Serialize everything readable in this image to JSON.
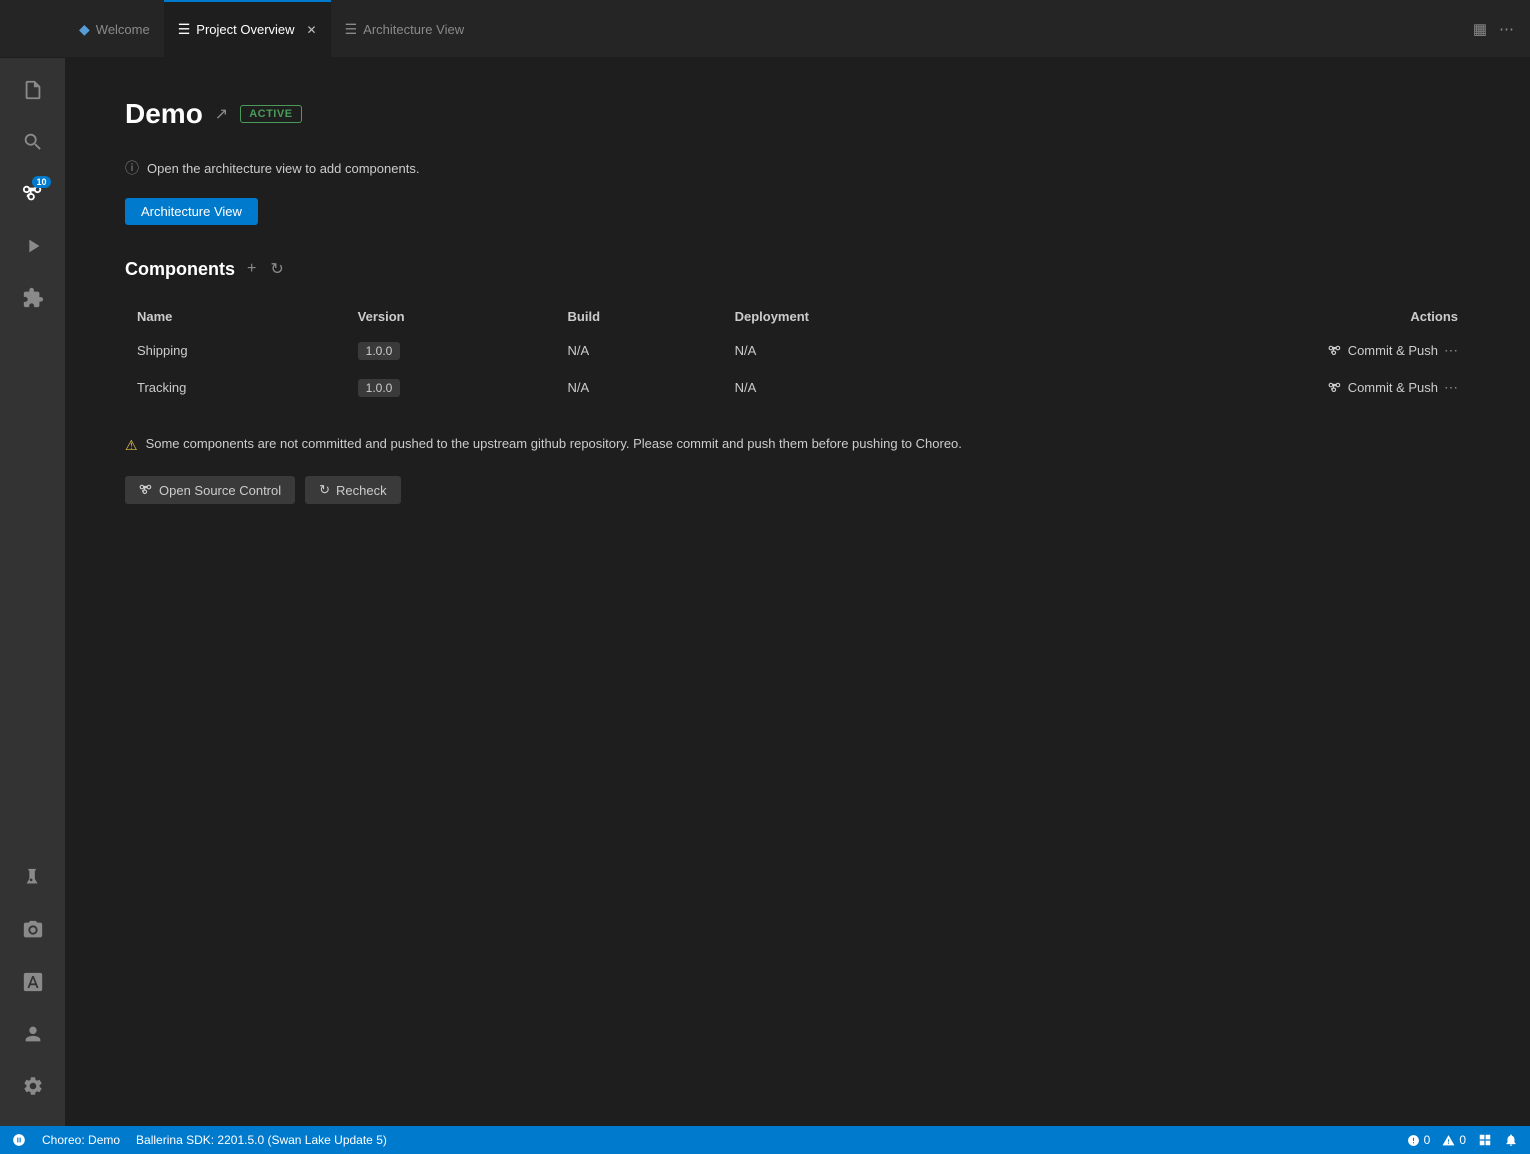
{
  "tabs": {
    "welcome": {
      "label": "Welcome",
      "icon": "⚡",
      "active": false
    },
    "project_overview": {
      "label": "Project Overview",
      "icon": "≡",
      "active": true,
      "closable": true
    },
    "architecture_view": {
      "label": "Architecture View",
      "icon": "≡",
      "active": false
    }
  },
  "activity_bar": {
    "items": [
      {
        "id": "files",
        "icon": "files",
        "badge": null
      },
      {
        "id": "search",
        "icon": "search",
        "badge": null
      },
      {
        "id": "source-control",
        "icon": "source-control",
        "badge": "10"
      },
      {
        "id": "run",
        "icon": "run",
        "badge": null
      },
      {
        "id": "extensions",
        "icon": "extensions",
        "badge": null
      },
      {
        "id": "flask",
        "icon": "flask",
        "badge": null
      },
      {
        "id": "camera",
        "icon": "camera",
        "badge": null
      },
      {
        "id": "font",
        "icon": "font",
        "badge": null
      }
    ],
    "bottom": [
      {
        "id": "account",
        "icon": "account"
      },
      {
        "id": "settings",
        "icon": "settings"
      }
    ]
  },
  "page": {
    "title": "Demo",
    "status_badge": "ACTIVE",
    "info_message": "Open the architecture view to add components.",
    "arch_button_label": "Architecture View",
    "components_section": {
      "title": "Components",
      "table": {
        "headers": [
          "Name",
          "Version",
          "Build",
          "Deployment",
          "Actions"
        ],
        "rows": [
          {
            "name": "Shipping",
            "version": "1.0.0",
            "build": "N/A",
            "deployment": "N/A",
            "action": "Commit & Push"
          },
          {
            "name": "Tracking",
            "version": "1.0.0",
            "build": "N/A",
            "deployment": "N/A",
            "action": "Commit & Push"
          }
        ]
      }
    },
    "warning_message": "Some components are not committed and pushed to the upstream github repository. Please commit and push them before pushing to Choreo.",
    "buttons": {
      "open_source_control": "Open Source Control",
      "recheck": "Recheck"
    }
  },
  "status_bar": {
    "choreo_label": "Choreo: Demo",
    "sdk_label": "Ballerina SDK: 2201.5.0 (Swan Lake Update 5)",
    "errors": "0",
    "warnings": "0"
  }
}
